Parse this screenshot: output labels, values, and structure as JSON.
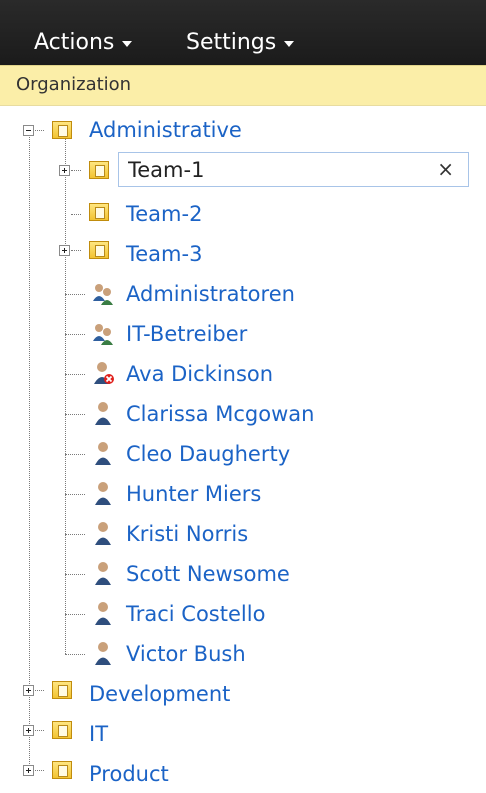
{
  "toolbar": {
    "actions_label": "Actions",
    "settings_label": "Settings"
  },
  "header": {
    "title": "Organization"
  },
  "tree": {
    "root": "Administrative",
    "edit": {
      "value": "Team-1",
      "clear": "×"
    },
    "team2": "Team-2",
    "team3": "Team-3",
    "groups": [
      "Administratoren",
      "IT-Betreiber"
    ],
    "users": [
      "Ava Dickinson",
      "Clarissa Mcgowan",
      "Cleo Daugherty",
      "Hunter Miers",
      "Kristi Norris",
      "Scott Newsome",
      "Traci Costello",
      "Victor Bush"
    ],
    "bottom": [
      "Development",
      "IT",
      "Product"
    ]
  },
  "colors": {
    "link": "#1b63c6",
    "bar": "#fbeea8",
    "toolbar": "#1f1f1f",
    "disabled_badge": "#e0201c"
  },
  "icons": {
    "group": "group-icon",
    "user": "user-icon",
    "disabled_user": "user-disabled-icon",
    "folder": "folder-icon"
  }
}
